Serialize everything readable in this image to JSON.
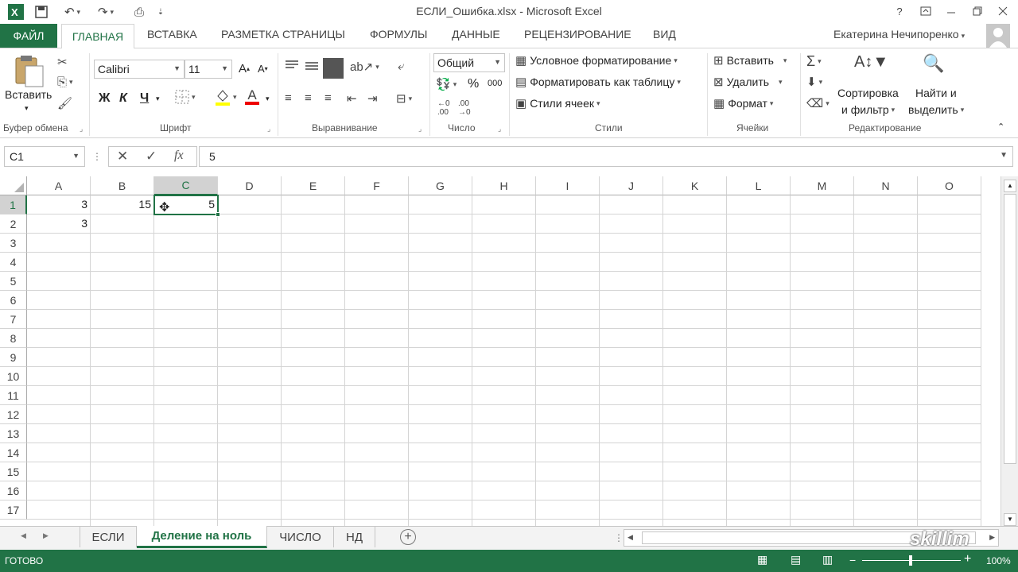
{
  "window": {
    "title": "ЕСЛИ_Ошибка.xlsx - Microsoft Excel",
    "help": "?",
    "user": "Екатерина Нечипоренко"
  },
  "tabs": {
    "file": "ФАЙЛ",
    "home": "ГЛАВНАЯ",
    "insert": "ВСТАВКА",
    "layout": "РАЗМЕТКА СТРАНИЦЫ",
    "formulas": "ФОРМУЛЫ",
    "data": "ДАННЫЕ",
    "review": "РЕЦЕНЗИРОВАНИЕ",
    "view": "ВИД"
  },
  "ribbon": {
    "clipboard": {
      "paste": "Вставить",
      "label": "Буфер обмена"
    },
    "font": {
      "name": "Calibri",
      "size": "11",
      "bold": "Ж",
      "italic": "К",
      "underline": "Ч",
      "grow": "A",
      "shrink": "A",
      "color_letter": "A",
      "label": "Шрифт"
    },
    "alignment": {
      "label": "Выравнивание"
    },
    "number": {
      "format": "Общий",
      "percent": "%",
      "thousands": "000",
      "label": "Число"
    },
    "styles": {
      "conditional": "Условное форматирование",
      "as_table": "Форматировать как таблицу",
      "cell_styles": "Стили ячеек",
      "label": "Стили"
    },
    "cells": {
      "insert": "Вставить",
      "delete": "Удалить",
      "format": "Формат",
      "label": "Ячейки"
    },
    "editing": {
      "sort_line1": "Сортировка",
      "sort_line2": "и фильтр",
      "find_line1": "Найти и",
      "find_line2": "выделить",
      "label": "Редактирование"
    }
  },
  "formula_bar": {
    "name_box": "C1",
    "fx": "fx",
    "value": "5"
  },
  "columns": [
    "A",
    "B",
    "C",
    "D",
    "E",
    "F",
    "G",
    "H",
    "I",
    "J",
    "K",
    "L",
    "M",
    "N",
    "O"
  ],
  "rows": [
    "1",
    "2",
    "3",
    "4",
    "5",
    "6",
    "7",
    "8",
    "9",
    "10",
    "11",
    "12",
    "13",
    "14",
    "15",
    "16",
    "17"
  ],
  "cells": {
    "A1": "3",
    "B1": "15",
    "C1": "5",
    "A2": "3"
  },
  "sheets": [
    "ЕСЛИ",
    "Деление на ноль",
    "ЧИСЛО",
    "НД"
  ],
  "active_sheet": "Деление на ноль",
  "status": {
    "ready": "ГОТОВО",
    "zoom": "100%"
  },
  "watermark": "skillim",
  "colors": {
    "accent": "#217346",
    "selected_header": "#d2d2d2"
  }
}
